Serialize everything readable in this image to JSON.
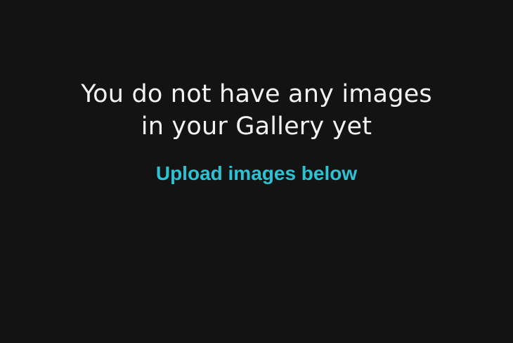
{
  "gallery": {
    "empty_title_line1": "You do not have any images",
    "empty_title_line2": "in your Gallery yet",
    "upload_hint": "Upload images below"
  },
  "colors": {
    "background": "#131313",
    "title_text": "#f2f2f2",
    "accent": "#2bc3d4"
  }
}
